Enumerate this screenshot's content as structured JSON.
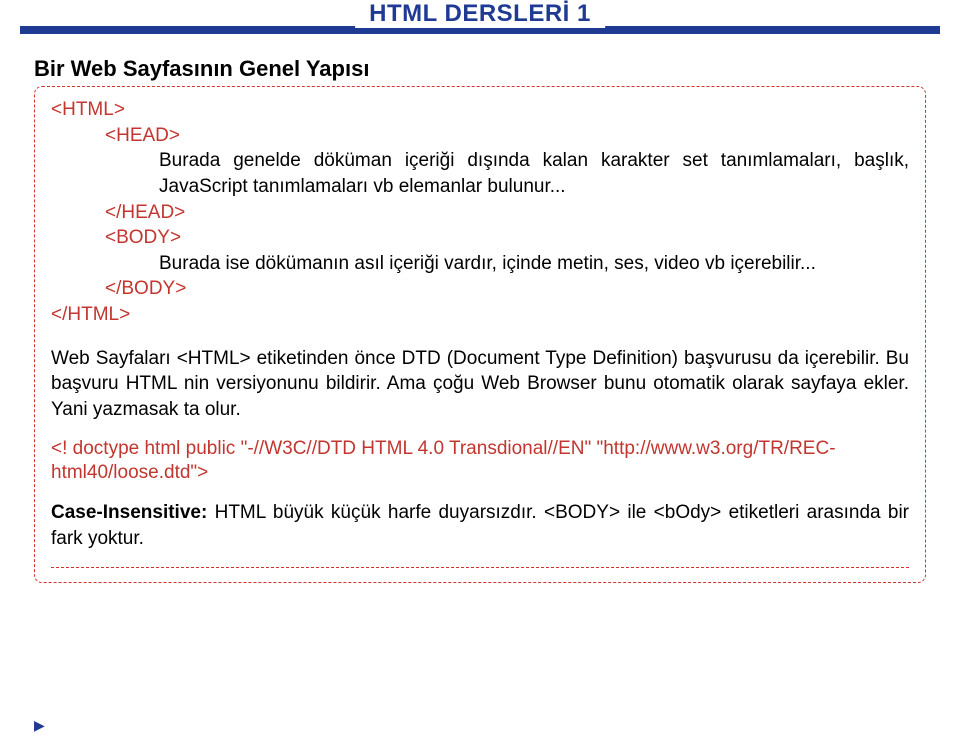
{
  "title": "HTML DERSLERİ 1",
  "subheading": "Bir Web Sayfasının Genel Yapısı",
  "code": {
    "html_open": "<HTML>",
    "head_open": "<HEAD>",
    "head_body": "Burada genelde döküman içeriği dışında kalan karakter set tanımlamaları, başlık, JavaScript tanımlamaları vb elemanlar bulunur...",
    "head_close": "</HEAD>",
    "body_open": "<BODY>",
    "body_body": "Burada ise dökümanın asıl içeriği vardır, içinde metin, ses, video vb içerebilir...",
    "body_close": "</BODY>",
    "html_close": "</HTML>"
  },
  "para1": "Web Sayfaları <HTML> etiketinden önce DTD (Document Type Definition) başvurusu da içerebilir. Bu başvuru HTML nin versiyonunu bildirir. Ama çoğu Web Browser bunu otomatik olarak sayfaya ekler. Yani yazmasak ta olur.",
  "doctype": "<! doctype html public \"-//W3C//DTD HTML 4.0 Transdional//EN\" \"http://www.w3.org/TR/REC-html40/loose.dtd\">",
  "case_label": "Case-Insensitive:",
  "case_text": " HTML büyük küçük harfe duyarsızdır. <BODY> ile <bOdy> etiketleri arasında bir fark yoktur.",
  "arrow": "▶"
}
